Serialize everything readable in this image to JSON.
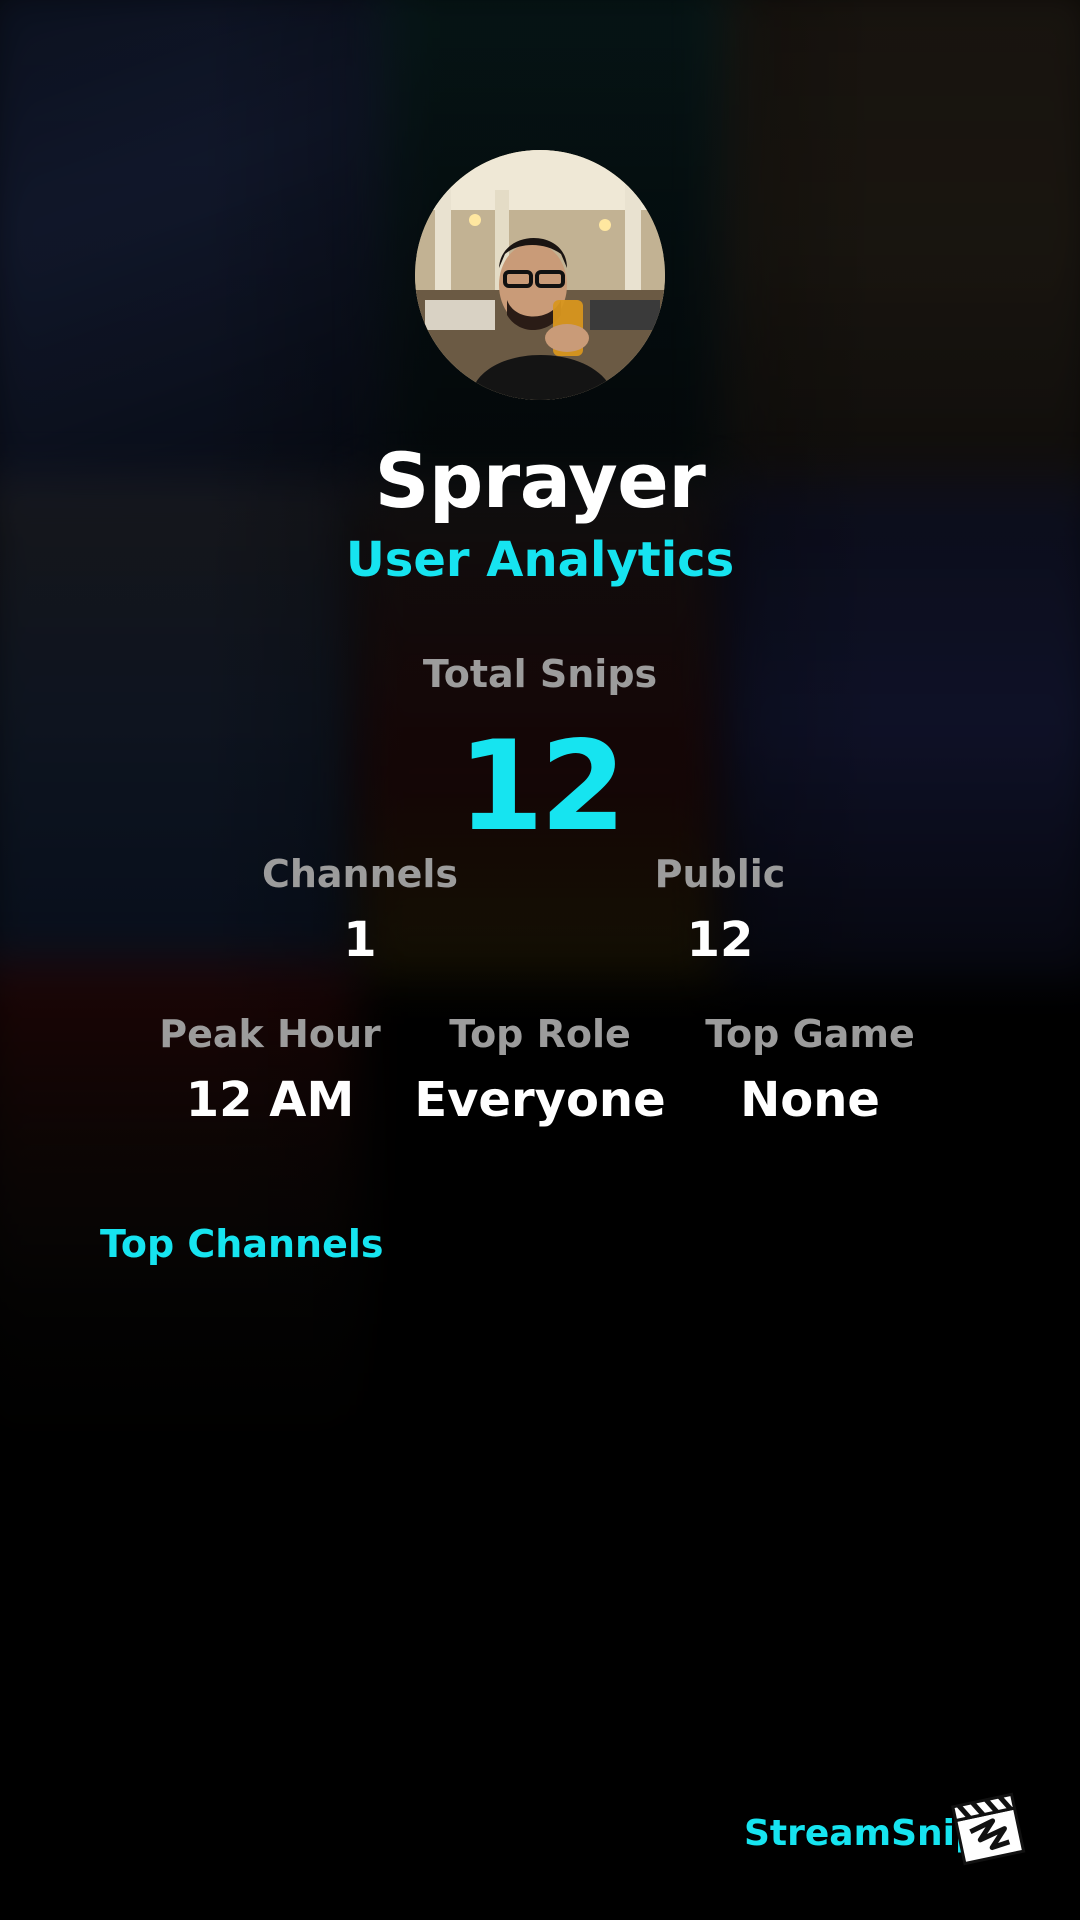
{
  "profile": {
    "name": "Sprayer",
    "subtitle": "User Analytics"
  },
  "stats": {
    "total_snips_label": "Total Snips",
    "total_snips_value": "12",
    "channels_label": "Channels",
    "channels_value": "1",
    "public_label": "Public",
    "public_value": "12",
    "peak_hour_label": "Peak Hour",
    "peak_hour_value": "12 AM",
    "top_role_label": "Top Role",
    "top_role_value": "Everyone",
    "top_game_label": "Top Game",
    "top_game_value": "None"
  },
  "sections": {
    "top_channels_label": "Top Channels"
  },
  "brand": {
    "name": "StreamSnip",
    "accent": "#16e4f0",
    "logo_icon": "clapperboard-icon"
  }
}
